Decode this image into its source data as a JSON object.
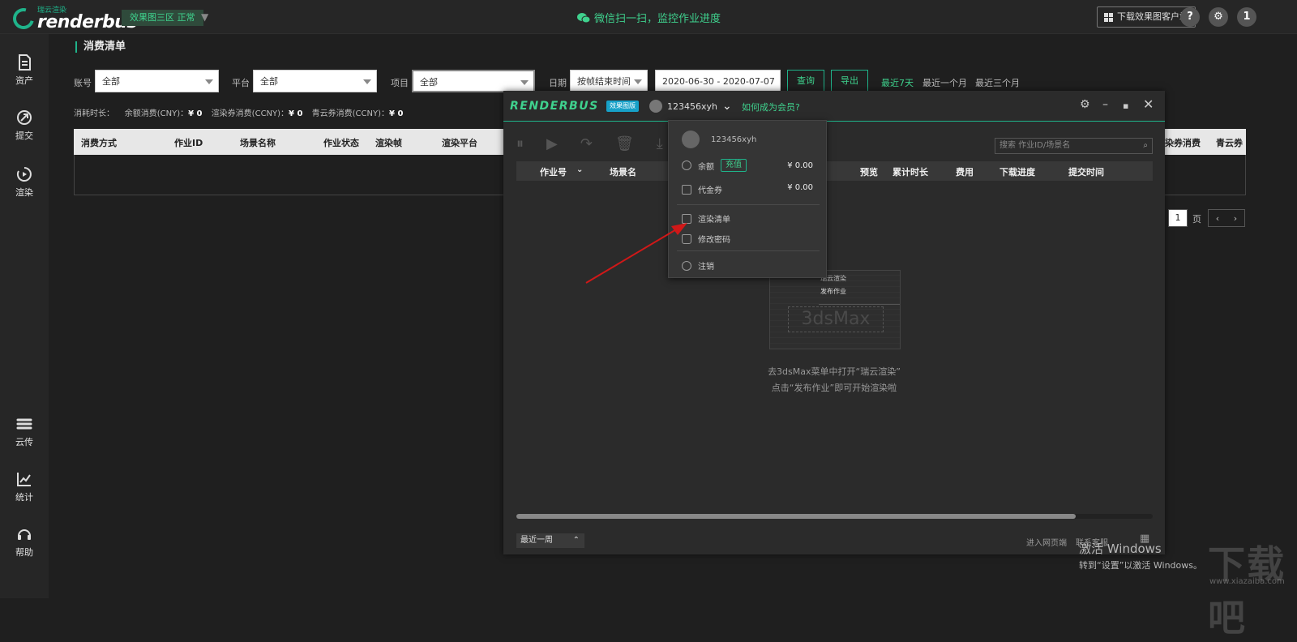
{
  "topbar": {
    "logo_sub": "瑞云渲染",
    "logo_main": "renderbus",
    "region": "效果图三区  正常",
    "wechat": "微信扫一扫，监控作业进度",
    "download_btn": "下载效果图客户端",
    "help": "?",
    "notify": "1"
  },
  "sidebar": {
    "items": [
      {
        "label": "资产"
      },
      {
        "label": "提交"
      },
      {
        "label": "渲染"
      },
      {
        "label": "云传"
      },
      {
        "label": "统计"
      },
      {
        "label": "帮助"
      }
    ]
  },
  "main": {
    "title": "消费清单",
    "filters": {
      "account_label": "账号",
      "account_value": "全部",
      "platform_label": "平台",
      "platform_value": "全部",
      "project_label": "项目",
      "project_value": "全部",
      "date_label": "日期",
      "date_type": "按帧结束时间",
      "date_range": "2020-06-30 - 2020-07-07",
      "query_btn": "查询",
      "export_btn": "导出",
      "quick_7": "最近7天",
      "quick_1m": "最近一个月",
      "quick_3m": "最近三个月"
    },
    "summary": {
      "dur_label": "消耗时长：",
      "bal_label": "余额消费(CNY)：",
      "bal_value": "¥ 0",
      "coupon_label": "渲染券消费(CCNY)：",
      "coupon_value": "¥ 0",
      "qy_label": "青云券消费(CCNY)：",
      "qy_value": "¥ 0"
    },
    "table_headers": [
      "消费方式",
      "作业ID",
      "场景名称",
      "作业状态",
      "渲染帧",
      "渲染平台",
      "染券消费",
      "青云券"
    ],
    "pager": {
      "page": "1",
      "page_unit": "页"
    }
  },
  "client": {
    "logo": "RENDERBUS",
    "badge": "效果图版",
    "user": "123456xyh",
    "member_link": "如何成为会员?",
    "search_placeholder": "搜索 作业ID/场景名",
    "headers": [
      "作业号",
      "场景名",
      "预览",
      "累计时长",
      "费用",
      "下载进度",
      "提交时间"
    ],
    "ill_menu1": "瑞云渲染",
    "ill_menu2": "发布作业",
    "ill_big": "3dsMax",
    "empty_line1": "去3dsMax菜单中打开“瑞云渲染”",
    "empty_line2": "点击“发布作业”即可开始渲染啦",
    "footer_select": "最近一周",
    "footer_link1": "进入网页端",
    "footer_link2": "联系客服"
  },
  "dropdown": {
    "user": "123456xyh",
    "balance_label": "余额",
    "recharge": "充值",
    "balance_value": "¥ 0.00",
    "coupon_label": "代金券",
    "coupon_value": "¥ 0.00",
    "render_list": "渲染清单",
    "change_pwd": "修改密码",
    "logout": "注销"
  },
  "watermark": {
    "line1": "激活 Windows",
    "line2": "转到“设置”以激活 Windows。",
    "site": "下载吧",
    "site_sub": "www.xiazaiba.com"
  },
  "colors": {
    "accent": "#1fb38a",
    "accent_text": "#3fd28e",
    "badge": "#17a1c8",
    "arrow": "#d01818"
  }
}
